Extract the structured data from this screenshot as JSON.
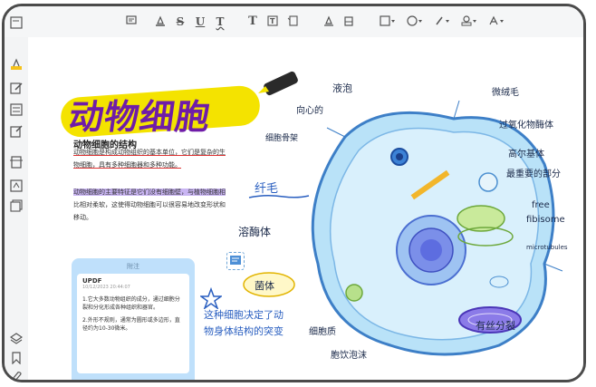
{
  "toolbar": {
    "icons": [
      "comment-icon",
      "highlight-icon",
      "strikethrough-icon",
      "underline-icon",
      "squiggly-icon",
      "text-icon",
      "textbox-icon",
      "callout-icon",
      "pencil-icon",
      "eraser-icon",
      "shape-icon",
      "sticker-icon",
      "attachment-icon",
      "stamp-icon",
      "signature-icon"
    ],
    "strike_label": "S",
    "underline_label": "U",
    "squiggly_label": "T",
    "text_label": "T"
  },
  "sidebar": {
    "icons": [
      "thumbnail-icon",
      "highlight-tool-icon",
      "edit-icon",
      "form-icon",
      "ocr-icon",
      "organize-icon",
      "convert-icon",
      "batch-icon",
      "layers-icon",
      "bookmark-icon",
      "attachment-icon"
    ]
  },
  "document": {
    "title": "动物细胞",
    "section_title": "动物细胞的结构",
    "para1_line1": "动物细胞是构成动物组织的基本单位，它们是复杂的生",
    "para1_line2": "物细胞，具有多种细胞器和多种功能。",
    "para2_line1": "动物细胞的主要特征是它们没有细胞壁，与植物细胞相",
    "para2_line2": "比相对柔软，这使得动物细胞可以很容易地改变形状和",
    "para2_line3": "移动。",
    "annotation_cilia": "纤毛",
    "annotation_bacteria": "菌体",
    "annotation_caption_line1": "这种细胞决定了动",
    "annotation_caption_line2": "物身体结构的突变"
  },
  "note": {
    "header": "附注",
    "user": "UPDF",
    "date": "10/12/2023 20:44:07",
    "line1": "1.它大多数动物组织的成分，通过细胞分裂和分化形成各种组织和器官。",
    "line2": "2.外形不规则，通常为圆形或多边形，直径约为10-30微米。",
    "colors": [
      "#111111",
      "#3b8ef0",
      "#f4c542",
      "#ef6d6d",
      "#7dd27a",
      "#b98ee8",
      "#f29ac9"
    ]
  },
  "labels": {
    "vacuole": "液泡",
    "centriole": "向心的",
    "golgi": "细胞骨架",
    "lysosome": "溶酶体",
    "microvilli": "微绒毛",
    "peroxisome": "过氧化物酶体",
    "golgi_body": "高尔基体",
    "most_important": "最重要的部分",
    "free_ribosome_1": "free",
    "free_ribosome_2": "fibisome",
    "microtubules": "microtubules",
    "cytoplasm": "细胞质",
    "pinocytic": "胞饮泡沫",
    "mitosis": "有丝分裂"
  }
}
